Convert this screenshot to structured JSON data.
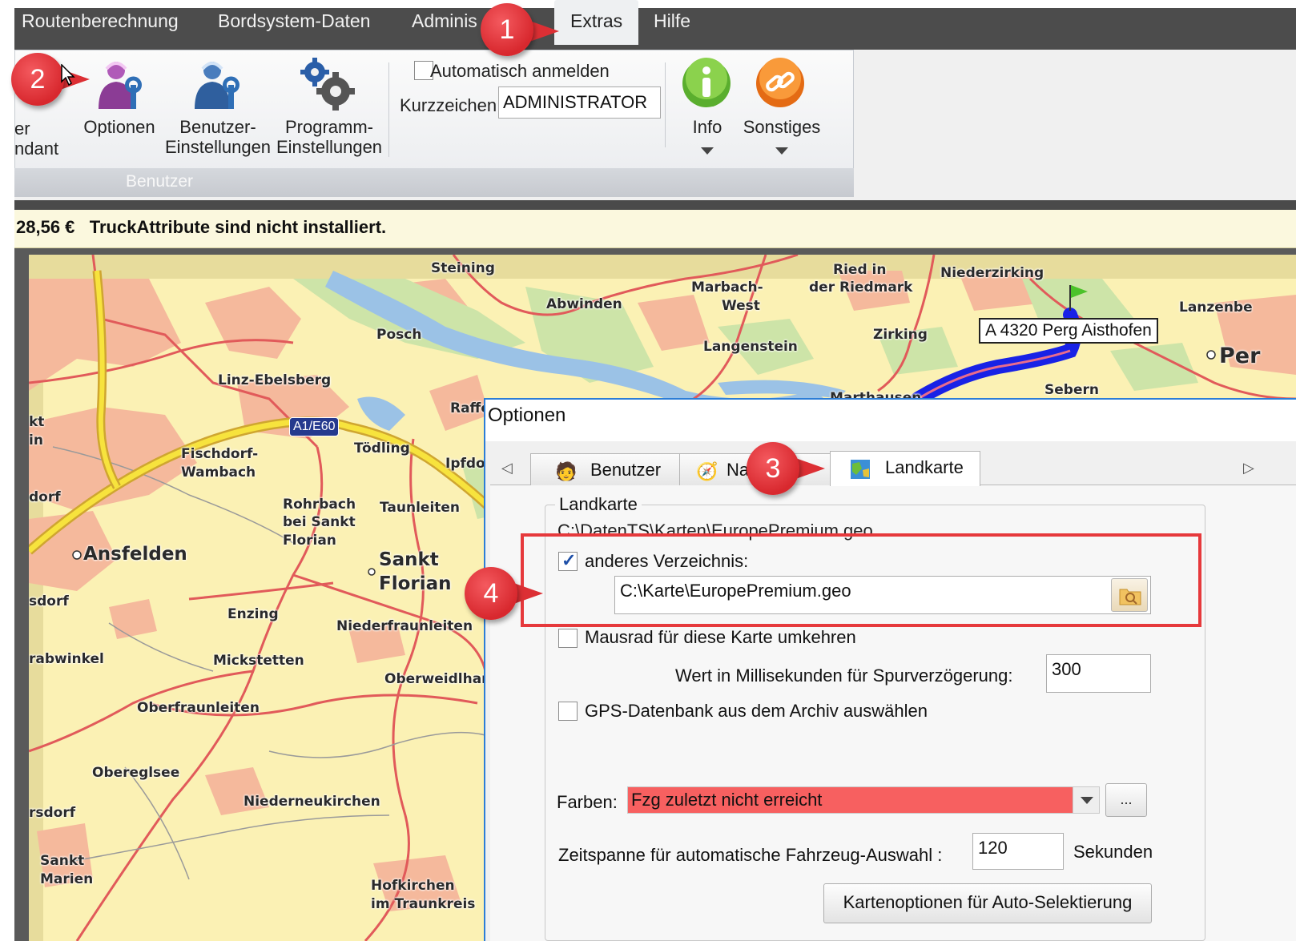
{
  "menu": {
    "tabs": [
      {
        "label": "Routenberechnung"
      },
      {
        "label": "Bordsystem-Daten"
      },
      {
        "label": "Adminis"
      },
      {
        "label": "Extras"
      },
      {
        "label": "Hilfe"
      }
    ],
    "active_tab": "Extras"
  },
  "ribbon": {
    "partial_left_line1": "er",
    "partial_left_line2": "ndant",
    "buttons": {
      "optionen": "Optionen",
      "benutzer_line1": "Benutzer-",
      "benutzer_line2": "Einstellungen",
      "programm_line1": "Programm-",
      "programm_line2": "Einstellungen",
      "info": "Info",
      "sonstiges": "Sonstiges"
    },
    "auto_login_label": "Automatisch anmelden",
    "kurzzeichen_label": "Kurzzeichen",
    "kurzzeichen_value": "ADMINISTRATOR",
    "group_label": "Benutzer"
  },
  "message": {
    "amount": "28,56 €",
    "text": "TruckAttribute sind nicht installiert."
  },
  "map": {
    "road_badge": "A1/E60",
    "route_tooltip": "A 4320 Perg Aisthofen",
    "places": [
      "Steining",
      "Ried in",
      "der Riedmark",
      "Marbach-",
      "West",
      "Niederzirking",
      "Abwinden",
      "Lanzenbe",
      "Posch",
      "Langenstein",
      "Zirking",
      "Per",
      "Linz-Ebelsberg",
      "Sebern",
      "Raffe",
      "Fischdorf-",
      "Wambach",
      "Tödling",
      "Ipfdo",
      "Rohrbach",
      "bei Sankt",
      "Florian",
      "Taunleiten",
      "Ansfelden",
      "Sankt",
      "Florian",
      "Enzing",
      "Niederfraunleiten",
      "Mickstetten",
      "Oberweidlhar",
      "Oberfraunleiten",
      "Obereglsee",
      "Niederneukirchen",
      "Hofkirchen",
      "im Traunkreis",
      "Sankt",
      "Marien",
      "rabwinkel",
      "dorf",
      "sdorf",
      "rsdorf",
      "kt",
      "in",
      "Marthausen"
    ],
    "colors": {
      "land": "#fbf1b4",
      "urban": "#f5b99c",
      "forest": "#cde4a8",
      "water": "#9bc2e6",
      "highway": "#f7e33d",
      "route": "#1822e6"
    }
  },
  "dialog": {
    "title": "Optionen",
    "tabs": [
      {
        "label": "Benutzer"
      },
      {
        "label": "Na"
      },
      {
        "label": "Landkarte"
      }
    ],
    "active_tab": "Landkarte",
    "group_title": "Landkarte",
    "current_path": "C:\\DatenTS\\Karten\\EuropePremium.geo",
    "other_dir_label": "anderes Verzeichnis:",
    "other_dir_checked": true,
    "other_dir_value": "C:\\Karte\\EuropePremium.geo",
    "mouse_wheel_label": "Mausrad für diese Karte umkehren",
    "mouse_wheel_checked": false,
    "delay_label": "Wert in Millisekunden für Spurverzögerung:",
    "delay_value": "300",
    "gps_label": "GPS-Datenbank aus dem Archiv auswählen",
    "gps_checked": false,
    "colors_label": "Farben:",
    "colors_value": "Fzg zuletzt nicht erreicht",
    "colors_value_color": "#f76060",
    "dots_label": "...",
    "timespan_label": "Zeitspanne für automatische Fahrzeug-Auswahl :",
    "timespan_value": "120",
    "timespan_unit": "Sekunden",
    "auto_select_button": "Kartenoptionen für Auto-Selektierung"
  },
  "callouts": [
    "1",
    "2",
    "3",
    "4"
  ]
}
